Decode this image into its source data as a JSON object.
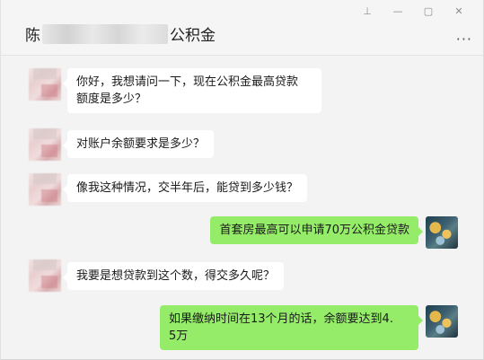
{
  "window": {
    "controls": [
      {
        "name": "pin-icon",
        "glyph": "⊥"
      },
      {
        "name": "minimize-icon",
        "glyph": "—"
      },
      {
        "name": "maximize-icon",
        "glyph": "▢"
      },
      {
        "name": "close-icon",
        "glyph": "✕"
      }
    ]
  },
  "header": {
    "title_prefix": "陈",
    "title_suffix": "公积金",
    "more_label": "···"
  },
  "messages": [
    {
      "side": "in",
      "text": "你好，我想请问一下，现在公积金最高贷款\n额度是多少？"
    },
    {
      "side": "in",
      "text": "对账户余额要求是多少？"
    },
    {
      "side": "in",
      "text": "像我这种情况，交半年后，能贷到多少钱？"
    },
    {
      "side": "out",
      "text": "首套房最高可以申请70万公积金贷款"
    },
    {
      "side": "in",
      "text": "我要是想贷款到这个数，得交多久呢？"
    },
    {
      "side": "out",
      "text": "如果缴纳时间在13个月的话，余额要达到4.\n5万"
    }
  ],
  "colors": {
    "incoming_bubble": "#ffffff",
    "outgoing_bubble": "#95ec69",
    "background": "#f3f3f3"
  }
}
